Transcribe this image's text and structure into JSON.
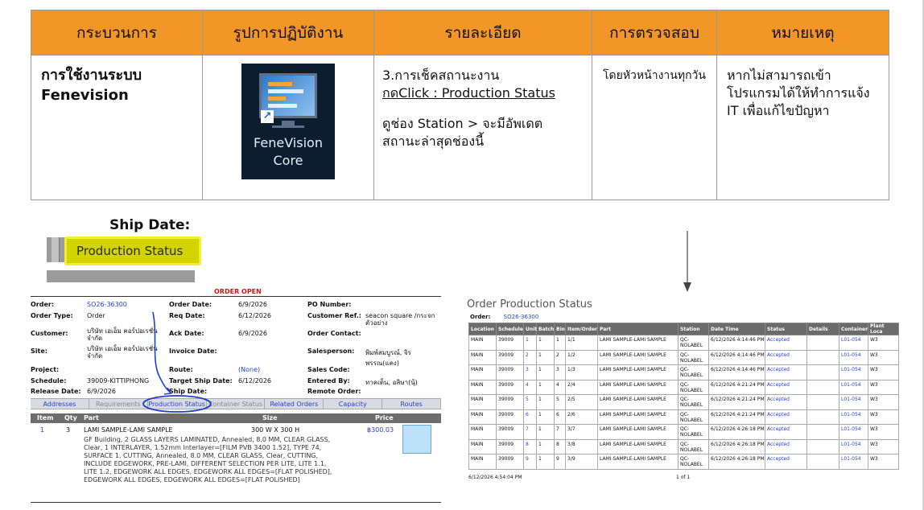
{
  "table": {
    "headers": [
      "กระบวนการ",
      "รูปการปฏิบัติงาน",
      "รายละเอียด",
      "การตรวจสอบ",
      "หมายเหตุ"
    ],
    "process_line1": "การใช้งานระบบ",
    "process_line2": "Fenevision",
    "app_icon": {
      "name_line1": "FeneVision",
      "name_line2": "Core",
      "icon": "monitor-app-icon"
    },
    "detail_line1": "3.การเช็คสถานะงาน",
    "detail_line2": "กดClick : Production Status",
    "detail_line3": "ดูช่อง Station > จะมีอัพเดต",
    "detail_line4": "สถานะล่าสุดช่องนี้",
    "check": "โดยหัวหน้างานทุกวัน",
    "note": "หากไม่สามารถเข้าโปรแกรมได้ให้ทำการแจ้ง IT  เพื่อแก้ไขปัญหา"
  },
  "ship_date_label": "Ship Date:",
  "production_status_label": "Production Status",
  "order_form": {
    "banner": "ORDER OPEN",
    "fields": {
      "order_l": "Order:",
      "order_v": "SO26-36300",
      "order_type_l": "Order Type:",
      "order_type_v": "Order",
      "customer_l": "Customer:",
      "customer_v": "บริษัท เอเอ็ม คอร์ปอเรชั่น จำกัด",
      "site_l": "Site:",
      "site_v": "บริษัท เอเอ็ม คอร์ปอเรชั่น จำกัด",
      "project_l": "Project:",
      "schedule_l": "Schedule:",
      "schedule_v": "39009-KITTIPHONG",
      "release_l": "Release Date:",
      "release_v": "6/9/2026",
      "order_date_l": "Order Date:",
      "order_date_v": "6/9/2026",
      "req_date_l": "Req Date:",
      "req_date_v": "6/12/2026",
      "ack_date_l": "Ack Date:",
      "ack_date_v": "6/9/2026",
      "invoice_date_l": "Invoice Date:",
      "route_l": "Route:",
      "route_v": "(None)",
      "target_ship_l": "Target Ship Date:",
      "target_ship_v": "6/12/2026",
      "ship_date_l": "Ship Date:",
      "po_l": "PO Number:",
      "cust_ref_l": "Customer Ref.:",
      "cust_ref_v": "seacon square /กระจกตัวอย่าง",
      "order_contact_l": "Order Contact:",
      "salesperson_l": "Salesperson:",
      "salesperson_v": "พิมพ์สมบูรณ์, จิรพรรณ(แคง)",
      "sales_code_l": "Sales Code:",
      "entered_by_l": "Entered By:",
      "entered_by_v": "ทาคเต็น, อลิษา(นุ้)",
      "remote_order_l": "Remote Order:"
    },
    "tabs": [
      "Addresses",
      "Requirements",
      "Production Status",
      "Container Status",
      "Related Orders",
      "Capacity",
      "Routes"
    ],
    "columns": [
      "Item",
      "Qty",
      "Part",
      "Size",
      "Price"
    ],
    "line": {
      "item": "1",
      "qty": "3",
      "part": "LAMI SAMPLE-LAMI SAMPLE",
      "size": "300 W X 300 H",
      "price": "฿300.03",
      "description": "GF Building, 2 GLASS LAYERS LAMINATED, Annealed, 8.0 MM, CLEAR GLASS, Clear, 1 INTERLAYER, 1.52mm Interlayer=[FILM PVB 3400 1.52], TYPE 74, SURFACE 1, CUTTING, Annealed, 8.0 MM, CLEAR GLASS, Clear, CUTTING, INCLUDE EDGEWORK, PRE-LAMI, DIFFERENT SELECTION PER LITE, LITE 1.1, LITE 1.2, EDGEWORK ALL EDGES, EDGEWORK ALL EDGES=[FLAT POLISHED], EDGEWORK ALL EDGES, EDGEWORK ALL EDGES=[FLAT POLISHED]"
    }
  },
  "production": {
    "title": "Order Production Status",
    "order_label": "Order:",
    "order_value": "SO26-36300",
    "columns": [
      "Location",
      "Schedule",
      "Unit",
      "Batch",
      "Bin",
      "Item/Order",
      "Part",
      "Station",
      "Date Time",
      "Status",
      "Details",
      "Container",
      "Plant Loca"
    ],
    "rows": [
      [
        "MAIN",
        "39009",
        "1",
        "1",
        "1",
        "1/1",
        "LAMI SAMPLE-LAMI SAMPLE",
        "QC-NOLABEL",
        "6/12/2026 4:14:46 PM",
        "Accepted",
        "",
        "L01-054",
        "W3"
      ],
      [
        "MAIN",
        "39009",
        "2",
        "1",
        "2",
        "1/2",
        "LAMI SAMPLE-LAMI SAMPLE",
        "QC-NOLABEL",
        "6/12/2026 4:14:46 PM",
        "Accepted",
        "",
        "L01-054",
        "W3"
      ],
      [
        "MAIN",
        "39009",
        "3",
        "1",
        "3",
        "1/3",
        "LAMI SAMPLE-LAMI SAMPLE",
        "QC-NOLABEL",
        "6/12/2026 4:14:46 PM",
        "Accepted",
        "",
        "L01-054",
        "W3"
      ],
      [
        "MAIN",
        "39009",
        "4",
        "1",
        "4",
        "2/4",
        "LAMI SAMPLE-LAMI SAMPLE",
        "QC-NOLABEL",
        "6/12/2026 4:21:24 PM",
        "Accepted",
        "",
        "L01-054",
        "W3"
      ],
      [
        "MAIN",
        "39009",
        "5",
        "1",
        "5",
        "2/5",
        "LAMI SAMPLE-LAMI SAMPLE",
        "QC-NOLABEL",
        "6/12/2026 4:21:24 PM",
        "Accepted",
        "",
        "L01-054",
        "W3"
      ],
      [
        "MAIN",
        "39009",
        "6",
        "1",
        "6",
        "2/6",
        "LAMI SAMPLE-LAMI SAMPLE",
        "QC-NOLABEL",
        "6/12/2026 4:21:24 PM",
        "Accepted",
        "",
        "L01-054",
        "W3"
      ],
      [
        "MAIN",
        "39009",
        "7",
        "1",
        "7",
        "3/7",
        "LAMI SAMPLE-LAMI SAMPLE",
        "QC-NOLABEL",
        "6/12/2026 4:26:18 PM",
        "Accepted",
        "",
        "L01-054",
        "W3"
      ],
      [
        "MAIN",
        "39009",
        "8",
        "1",
        "8",
        "3/8",
        "LAMI SAMPLE-LAMI SAMPLE",
        "QC-NOLABEL",
        "6/12/2026 4:26:18 PM",
        "Accepted",
        "",
        "L01-054",
        "W3"
      ],
      [
        "MAIN",
        "39009",
        "9",
        "1",
        "9",
        "3/9",
        "LAMI SAMPLE-LAMI SAMPLE",
        "QC-NOLABEL",
        "6/12/2026 4:26:18 PM",
        "Accepted",
        "",
        "L01-054",
        "W3"
      ]
    ],
    "footer_time": "6/12/2026 4:54:04 PM",
    "footer_page": "1 of 1"
  },
  "colors": {
    "header_orange": "#f29628",
    "highlight_yellow": "#d3d300",
    "link_blue": "#2644c8",
    "annotation_blue": "#1f3fd0"
  }
}
